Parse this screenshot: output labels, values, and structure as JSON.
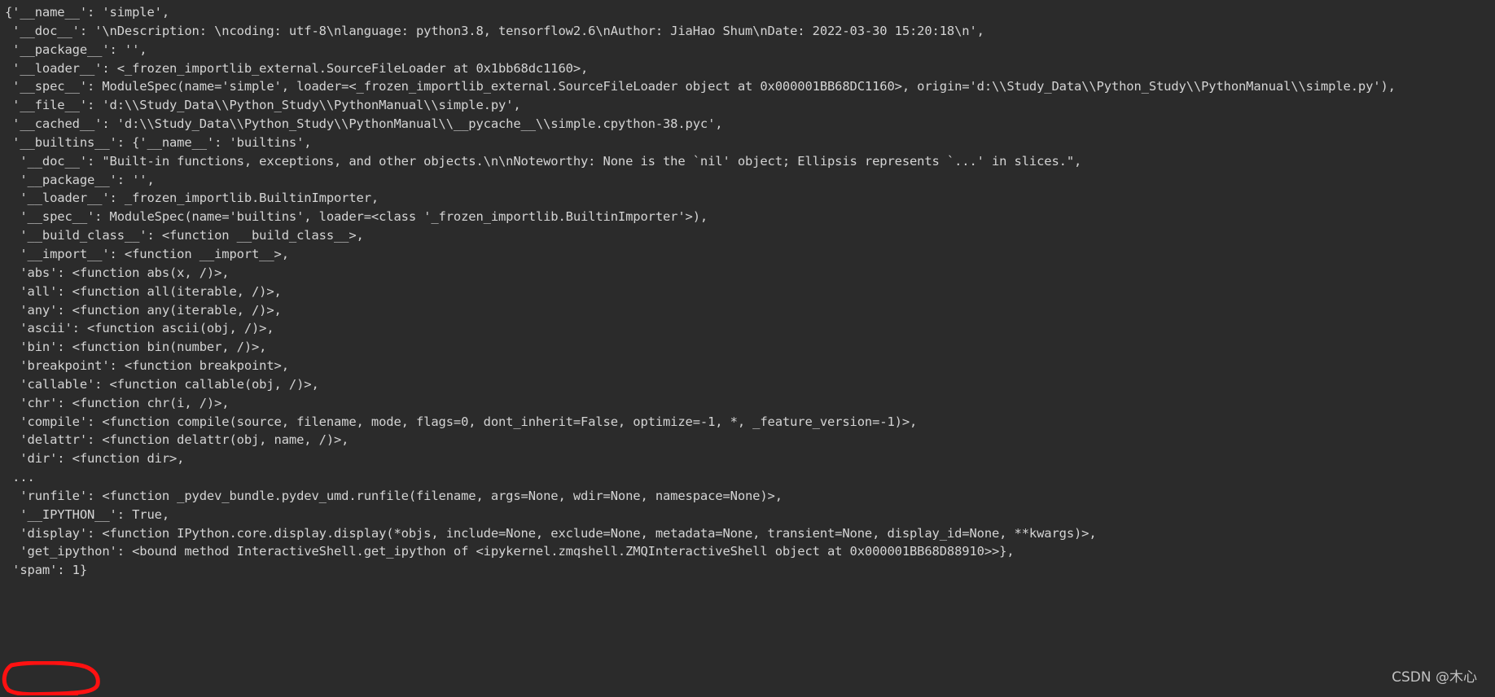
{
  "console": {
    "background_color": "#2b2b2b",
    "text_color": "#d4d4d4",
    "annotation_color": "#ff0000",
    "lines": [
      "{'__name__': 'simple',",
      " '__doc__': '\\nDescription: \\ncoding: utf-8\\nlanguage: python3.8, tensorflow2.6\\nAuthor: JiaHao Shum\\nDate: 2022-03-30 15:20:18\\n',",
      " '__package__': '',",
      " '__loader__': <_frozen_importlib_external.SourceFileLoader at 0x1bb68dc1160>,",
      " '__spec__': ModuleSpec(name='simple', loader=<_frozen_importlib_external.SourceFileLoader object at 0x000001BB68DC1160>, origin='d:\\\\Study_Data\\\\Python_Study\\\\PythonManual\\\\simple.py'),",
      " '__file__': 'd:\\\\Study_Data\\\\Python_Study\\\\PythonManual\\\\simple.py',",
      " '__cached__': 'd:\\\\Study_Data\\\\Python_Study\\\\PythonManual\\\\__pycache__\\\\simple.cpython-38.pyc',",
      " '__builtins__': {'__name__': 'builtins',",
      "  '__doc__': \"Built-in functions, exceptions, and other objects.\\n\\nNoteworthy: None is the `nil' object; Ellipsis represents `...' in slices.\",",
      "  '__package__': '',",
      "  '__loader__': _frozen_importlib.BuiltinImporter,",
      "  '__spec__': ModuleSpec(name='builtins', loader=<class '_frozen_importlib.BuiltinImporter'>),",
      "  '__build_class__': <function __build_class__>,",
      "  '__import__': <function __import__>,",
      "  'abs': <function abs(x, /)>,",
      "  'all': <function all(iterable, /)>,",
      "  'any': <function any(iterable, /)>,",
      "  'ascii': <function ascii(obj, /)>,",
      "  'bin': <function bin(number, /)>,",
      "  'breakpoint': <function breakpoint>,",
      "  'callable': <function callable(obj, /)>,",
      "  'chr': <function chr(i, /)>,",
      "  'compile': <function compile(source, filename, mode, flags=0, dont_inherit=False, optimize=-1, *, _feature_version=-1)>,",
      "  'delattr': <function delattr(obj, name, /)>,",
      "  'dir': <function dir>,",
      " ...",
      "  'runfile': <function _pydev_bundle.pydev_umd.runfile(filename, args=None, wdir=None, namespace=None)>,",
      "  '__IPYTHON__': True,",
      "  'display': <function IPython.core.display.display(*objs, include=None, exclude=None, metadata=None, transient=None, display_id=None, **kwargs)>,",
      "  'get_ipython': <bound method InteractiveShell.get_ipython of <ipykernel.zmqshell.ZMQInteractiveShell object at 0x000001BB68D88910>>},",
      " 'spam': 1}"
    ]
  },
  "annotation": {
    "name": "red-ellipse-highlight",
    "target_text": "'spam': 1}",
    "color": "#ff0000"
  },
  "watermark": {
    "text": "CSDN @木心"
  }
}
